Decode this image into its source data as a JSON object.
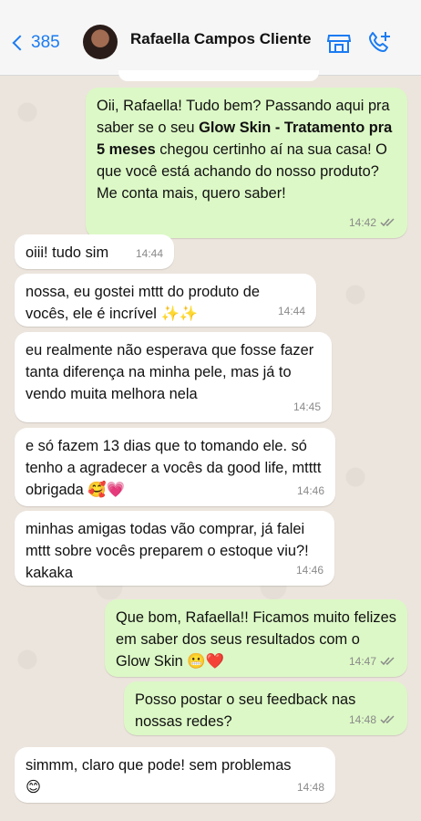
{
  "header": {
    "back_count": "385",
    "contact_name": "Rafaella Campos Cliente"
  },
  "icons": {
    "back": "chevron-left-icon",
    "store": "store-icon",
    "call": "call-plus-icon"
  },
  "colors": {
    "accent": "#1a7bf2",
    "outgoing_bubble": "#dcf8c6",
    "incoming_bubble": "#ffffff",
    "chat_bg": "#ece5dd"
  },
  "messages": [
    {
      "dir": "out",
      "text_pre": "Oii, Rafaella! Tudo bem? Passando aqui pra saber se o seu ",
      "text_bold": "Glow Skin - Tratamento pra 5 meses",
      "text_post": " chegou certinho aí na sua casa! O que você está achando do nosso produto? Me conta mais, quero saber!",
      "time": "14:42"
    },
    {
      "dir": "in",
      "text": "oiii! tudo sim",
      "time": "14:44"
    },
    {
      "dir": "in",
      "text": "nossa, eu gostei mttt do produto de vocês, ele é incrível ✨✨",
      "time": "14:44"
    },
    {
      "dir": "in",
      "text": "eu realmente não esperava que fosse fazer tanta diferença na minha pele, mas já to vendo muita melhora nela",
      "time": "14:45"
    },
    {
      "dir": "in",
      "text": "e só fazem 13 dias que to tomando ele. só tenho a agradecer a vocês da good life, mtttt obrigada 🥰💗",
      "time": "14:46"
    },
    {
      "dir": "in",
      "text": "minhas amigas todas vão comprar, já falei mttt sobre vocês preparem o estoque viu?! kakaka",
      "time": "14:46"
    },
    {
      "dir": "out",
      "text": "Que bom, Rafaella!! Ficamos muito felizes em saber dos seus resultados com o Glow Skin 😬❤️",
      "time": "14:47"
    },
    {
      "dir": "out",
      "text": "Posso postar o seu feedback nas nossas redes?",
      "time": "14:48"
    },
    {
      "dir": "in",
      "text": "simmm, claro que pode! sem problemas 😊",
      "time": "14:48"
    }
  ]
}
